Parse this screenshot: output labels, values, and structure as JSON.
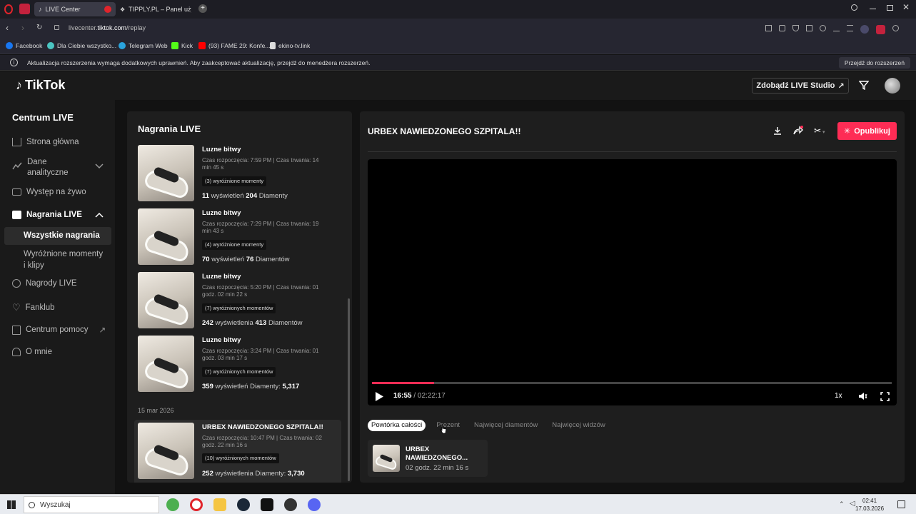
{
  "browser": {
    "tabs": [
      {
        "title": "LIVE Center",
        "active": true
      },
      {
        "title": "TIPPLY.PL – Panel użytkow",
        "active": false
      }
    ],
    "url_prefix": "livecenter.",
    "url_domain": "tiktok.com",
    "url_path": "/replay",
    "bookmarks": [
      "Facebook",
      "Dla Ciebie wszystko...",
      "Telegram Web",
      "Kick",
      "(93) FAME 29: Konfe...",
      "ekino-tv.link"
    ],
    "infobar_text": "Aktualizacja rozszerzenia wymaga dodatkowych uprawnień. Aby zaakceptować aktualizację, przejdź do menedżera rozszerzeń.",
    "infobar_button": "Przejdź do rozszerzeń"
  },
  "app": {
    "logo": "TikTok",
    "studio_button": "Zdobądź LIVE Studio"
  },
  "sidebar": {
    "title": "Centrum LIVE",
    "items": [
      "Strona główna",
      "Dane",
      "analityczne",
      "Występ na żywo",
      "Nagrania LIVE",
      "Nagrody LIVE",
      "Fanklub",
      "Centrum pomocy",
      "O mnie"
    ],
    "subitems": [
      "Wszystkie nagrania",
      "Wyróżnione momenty",
      "i klipy"
    ]
  },
  "recordings": {
    "title": "Nagrania LIVE",
    "date_header": "15 mar 2026",
    "items": [
      {
        "title": "Luzne bitwy",
        "meta1": "Czas rozpoczęcia: 7:59 PM | Czas trwania: 14",
        "meta2": "min 45 s",
        "badge": "(3) wyróżnione momenty",
        "views": "11",
        "views_label": " wyświetleń ",
        "diamonds": "204",
        "diamonds_label": " Diamenty"
      },
      {
        "title": "Luzne bitwy",
        "meta1": "Czas rozpoczęcia: 7:29 PM | Czas trwania: 19",
        "meta2": "min 43 s",
        "badge": "(4) wyróżnione momenty",
        "views": "70",
        "views_label": " wyświetleń ",
        "diamonds": "76",
        "diamonds_label": " Diamentów"
      },
      {
        "title": "Luzne bitwy",
        "meta1": "Czas rozpoczęcia: 5:20 PM | Czas trwania: 01",
        "meta2": "godz. 02 min 22 s",
        "badge": "(7) wyróżnionych momentów",
        "views": "242",
        "views_label": " wyświetlenia ",
        "diamonds": "413",
        "diamonds_label": " Diamentów"
      },
      {
        "title": "Luzne bitwy",
        "meta1": "Czas rozpoczęcia: 3:24 PM | Czas trwania: 01",
        "meta2": "godz. 03 min 17 s",
        "badge": "(7) wyróżnionych momentów",
        "views": "359",
        "views_label": " wyświetleń ",
        "diamonds": "5,317",
        "diamonds_label": "Diamenty: "
      },
      {
        "title": "URBEX NAWIEDZONEGO SZPITALA!!",
        "meta1": "Czas rozpoczęcia: 10:47 PM | Czas trwania: 02",
        "meta2": "godz. 22 min 16 s",
        "badge": "(10) wyróżnionych momentów",
        "views": "252",
        "views_label": " wyświetlenia ",
        "diamonds": "3,730",
        "diamonds_label": "Diamenty: "
      }
    ]
  },
  "player": {
    "title": "URBEX NAWIEDZONEGO SZPITALA!!",
    "publish_button": "Opublikuj",
    "current_time": "16:55",
    "separator": " / ",
    "duration": "02:22:17",
    "progress": 0.119,
    "speed": "1x",
    "filter_tabs": [
      "Powtórka całości",
      "Prezent",
      "Najwięcej diamentów",
      "Najwięcej widzów"
    ],
    "clip_title": "URBEX NAWIEDZONEGO...",
    "clip_duration": "02 godz. 22 min 16 s"
  },
  "taskbar": {
    "search_placeholder": "Wyszukaj",
    "time": "02:41",
    "date": "17.03.2026"
  },
  "colors": {
    "accent": "#fe2c55",
    "bg": "#121212",
    "panel": "#1e1e1e"
  }
}
